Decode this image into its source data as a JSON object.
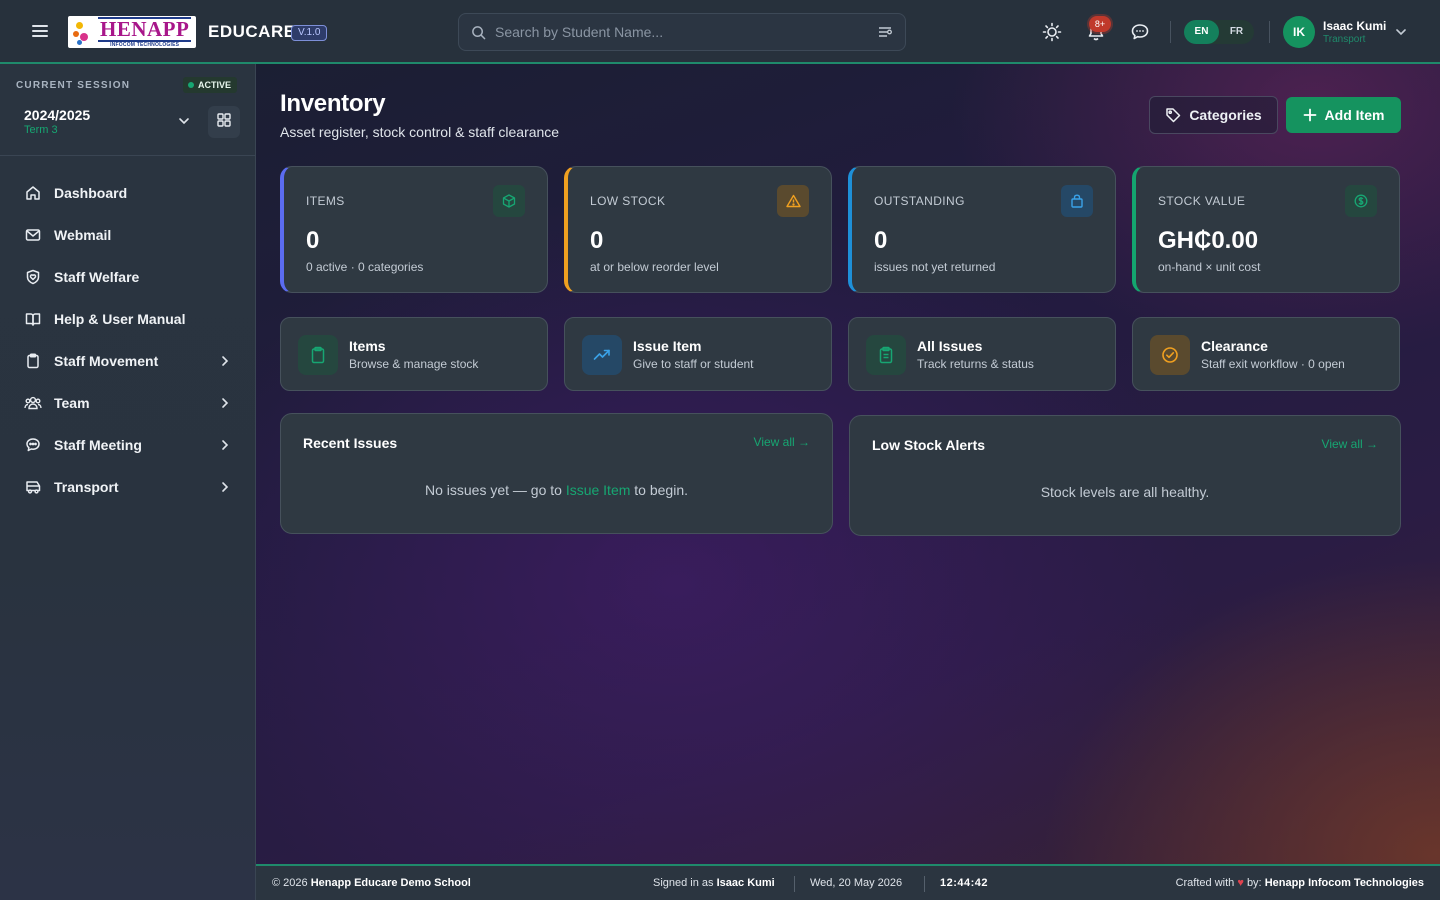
{
  "brand": {
    "logo_main": "HENAPP",
    "logo_sub": "INFOCOM TECHNOLOGIES",
    "name": "EDUCARE",
    "version": "V.1.0"
  },
  "search": {
    "placeholder": "Search by Student Name..."
  },
  "topbar": {
    "notification_count": "8+",
    "languages": [
      "EN",
      "FR"
    ],
    "active_language": "EN",
    "user": {
      "initials": "IK",
      "name": "Isaac Kumi",
      "role": "Transport"
    }
  },
  "session": {
    "label": "CURRENT SESSION",
    "status": "ACTIVE",
    "year": "2024/2025",
    "term": "Term 3"
  },
  "nav": {
    "items": [
      {
        "label": "Dashboard",
        "icon": "home-icon"
      },
      {
        "label": "Webmail",
        "icon": "mail-icon"
      },
      {
        "label": "Staff Welfare",
        "icon": "shield-heart-icon"
      },
      {
        "label": "Help & User Manual",
        "icon": "book-icon"
      },
      {
        "label": "Staff Movement",
        "icon": "clipboard-icon",
        "expandable": true
      },
      {
        "label": "Team",
        "icon": "users-icon",
        "expandable": true
      },
      {
        "label": "Staff Meeting",
        "icon": "chat-icon",
        "expandable": true
      },
      {
        "label": "Transport",
        "icon": "bus-icon",
        "expandable": true
      }
    ]
  },
  "page": {
    "title": "Inventory",
    "subtitle": "Asset register, stock control & staff clearance",
    "categories_label": "Categories",
    "add_item_label": "Add Item"
  },
  "stats": [
    {
      "label": "ITEMS",
      "value": "0",
      "sub": "0 active · 0 categories",
      "accent": "#5b6cf0",
      "icon": "cube-icon"
    },
    {
      "label": "LOW STOCK",
      "value": "0",
      "sub": "at or below reorder level",
      "accent": "#f0a020",
      "icon": "warning-icon"
    },
    {
      "label": "OUTSTANDING",
      "value": "0",
      "sub": "issues not yet returned",
      "accent": "#1e90d8",
      "icon": "bag-icon"
    },
    {
      "label": "STOCK VALUE",
      "value": "GH₵0.00",
      "sub": "on-hand × unit cost",
      "accent": "#14a56f",
      "icon": "dollar-icon"
    }
  ],
  "quick_links": [
    {
      "title": "Items",
      "sub": "Browse & manage stock",
      "icon": "clipboard-icon"
    },
    {
      "title": "Issue Item",
      "sub": "Give to staff or student",
      "icon": "trend-icon"
    },
    {
      "title": "All Issues",
      "sub": "Track returns & status",
      "icon": "list-icon"
    },
    {
      "title": "Clearance",
      "sub": "Staff exit workflow · 0 open",
      "icon": "check-circle-icon"
    }
  ],
  "recent_issues": {
    "title": "Recent Issues",
    "view_all": "View all →",
    "empty_before": "No issues yet — go to",
    "empty_link": "Issue Item",
    "empty_after": "to begin."
  },
  "low_stock": {
    "title": "Low Stock Alerts",
    "view_all": "View all →",
    "empty": "Stock levels are all healthy."
  },
  "footer": {
    "copyright": "© 2026",
    "school": "Henapp Educare Demo School",
    "signed_in_prefix": "Signed in as",
    "signed_in_user": "Isaac Kumi",
    "date": "Wed, 20 May 2026",
    "time": "12:44:42",
    "crafted_prefix": "Crafted with",
    "heart": "♥",
    "crafted_by": "by:",
    "company": "Henapp Infocom Technologies"
  }
}
